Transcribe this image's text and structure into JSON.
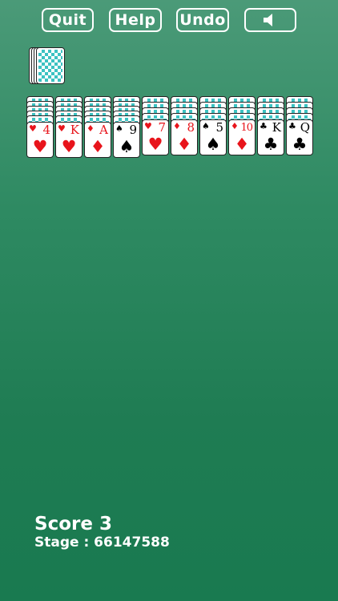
{
  "toolbar": {
    "quit_label": "Quit",
    "help_label": "Help",
    "undo_label": "Undo",
    "sound_icon": "speaker-icon"
  },
  "colors": {
    "background_top": "#4b9a78",
    "background_bottom": "#197a50",
    "card_back_pattern": "#3cc2c2",
    "red_suit": "#e8141b",
    "black_suit": "#000000"
  },
  "stock": {
    "facedown_cards_visible": 4
  },
  "tableau": [
    {
      "rank": "4",
      "suit": "hearts",
      "symbol": "♥",
      "color": "red",
      "facedown": 5
    },
    {
      "rank": "K",
      "suit": "hearts",
      "symbol": "♥",
      "color": "red",
      "facedown": 5
    },
    {
      "rank": "A",
      "suit": "diamonds",
      "symbol": "♦",
      "color": "red",
      "facedown": 5
    },
    {
      "rank": "9",
      "suit": "spades",
      "symbol": "♠",
      "color": "black",
      "facedown": 5
    },
    {
      "rank": "7",
      "suit": "hearts",
      "symbol": "♥",
      "color": "red",
      "facedown": 4
    },
    {
      "rank": "8",
      "suit": "diamonds",
      "symbol": "♦",
      "color": "red",
      "facedown": 4
    },
    {
      "rank": "5",
      "suit": "spades",
      "symbol": "♠",
      "color": "black",
      "facedown": 4
    },
    {
      "rank": "10",
      "suit": "diamonds",
      "symbol": "♦",
      "color": "red",
      "facedown": 4
    },
    {
      "rank": "K",
      "suit": "clubs",
      "symbol": "♣",
      "color": "black",
      "facedown": 4
    },
    {
      "rank": "Q",
      "suit": "clubs",
      "symbol": "♣",
      "color": "black",
      "facedown": 4
    }
  ],
  "status": {
    "score_label": "Score 3",
    "stage_label": "Stage : 66147588"
  }
}
